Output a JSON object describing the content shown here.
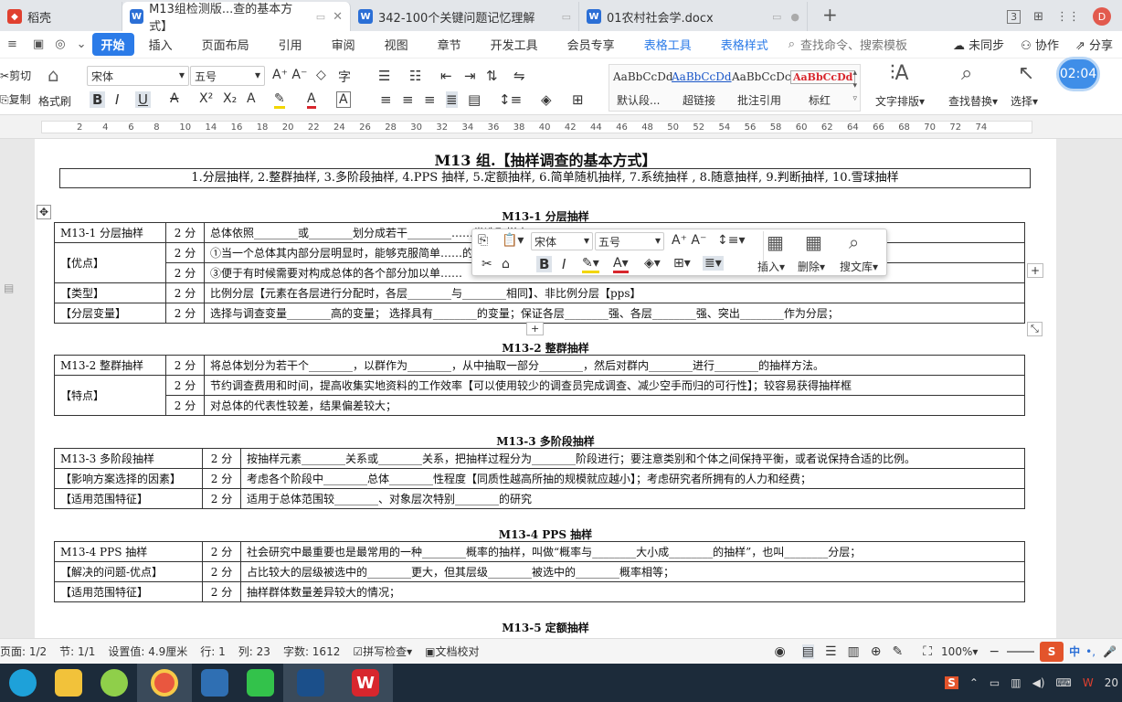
{
  "tabs": [
    {
      "label": "稻壳",
      "icon": "daoke-icon"
    },
    {
      "label": "M13组检测版...查的基本方式】",
      "icon": "word-doc-icon",
      "active": true
    },
    {
      "label": "342-100个关键问题记忆理解",
      "icon": "word-doc-icon"
    },
    {
      "label": "01农村社会学.docx",
      "icon": "word-doc-icon"
    }
  ],
  "window": {
    "avatar_letter": "D",
    "page_count_icon": "3"
  },
  "menu": {
    "items": [
      "开始",
      "插入",
      "页面布局",
      "引用",
      "审阅",
      "视图",
      "章节",
      "开发工具",
      "会员专享",
      "表格工具",
      "表格样式"
    ],
    "search_placeholder": "查找命令、搜索模板",
    "right": [
      "未同步",
      "协作",
      "分享"
    ]
  },
  "ribbon": {
    "cut": "剪切",
    "copy": "复制",
    "format_painter": "格式刷",
    "font_name": "宋体",
    "font_size": "五号",
    "styles": [
      {
        "sample": "AaBbCcDd",
        "label": "默认段...",
        "color": "#222222"
      },
      {
        "sample": "AaBbCcDd",
        "label": "超链接",
        "color": "#1a56c8"
      },
      {
        "sample": "AaBbCcDc",
        "label": "批注引用",
        "color": "#222222"
      },
      {
        "sample": "AaBbCcDd",
        "label": "标红",
        "color": "#d8262d"
      }
    ],
    "text_layout": "文字排版",
    "find_replace": "查找替换",
    "select": "选择",
    "clock": "02:04"
  },
  "ruler": [
    "2",
    "4",
    "6",
    "8",
    "10",
    "14",
    "16",
    "18",
    "20",
    "22",
    "24",
    "26",
    "28",
    "30",
    "32",
    "34",
    "36",
    "38",
    "40",
    "42",
    "44",
    "46",
    "48",
    "50",
    "52",
    "54",
    "56",
    "58",
    "60",
    "62",
    "64",
    "66",
    "68",
    "70",
    "72",
    "74"
  ],
  "doc": {
    "title": "M13 组.【抽样调查的基本方式】",
    "subtitle": "1.分层抽样, 2.整群抽样, 3.多阶段抽样, 4.PPS 抽样, 5.定额抽样, 6.简单随机抽样, 7.系统抽样 , 8.随意抽样, 9.判断抽样, 10.雪球抽样",
    "s1": {
      "heading": "M13-1 分层抽样",
      "rows": [
        [
          "M13-1 分层抽样",
          "2 分",
          "总体依照________或________划分成若干________……类选取样本；"
        ],
        [
          "【优点】",
          "2 分",
          "①当一个总体其内部分层明显时，能够克服简单……的________；"
        ],
        [
          "",
          "2 分",
          "③便于有时候需要对构成总体的各个部分加以单……"
        ],
        [
          "【类型】",
          "2 分",
          "比例分层【元素在各层进行分配时，各层________与________相同】、非比例分层【pps】"
        ],
        [
          "【分层变量】",
          "2 分",
          "选择与调查变量________高的变量； 选择具有________的变量；保证各层________强、各层________强、突出________作为分层；"
        ]
      ]
    },
    "s2": {
      "heading": "M13-2 整群抽样",
      "rows": [
        [
          "M13-2 整群抽样",
          "2 分",
          "将总体划分为若干个________，以群作为________，从中抽取一部分________，然后对群内________进行________的抽样方法。"
        ],
        [
          "【特点】",
          "2 分",
          "节约调查费用和时间，提高收集实地资料的工作效率【可以使用较少的调查员完成调查、减少空手而归的可行性】；较容易获得抽样框"
        ],
        [
          "",
          "2 分",
          "对总体的代表性较差，结果偏差较大；"
        ]
      ]
    },
    "s3": {
      "heading": "M13-3 多阶段抽样",
      "rows": [
        [
          "M13-3 多阶段抽样",
          "2 分",
          "按抽样元素________关系或________关系，把抽样过程分为________阶段进行；要注意类别和个体之间保持平衡，或者说保持合适的比例。"
        ],
        [
          "【影响方案选择的因素】",
          "2 分",
          "考虑各个阶段中________总体________性程度【同质性越高所抽的规模就应越小】；考虑研究者所拥有的人力和经费；"
        ],
        [
          "【适用范围特征】",
          "2 分",
          "适用于总体范围较________、对象层次特别________的研究"
        ]
      ]
    },
    "s4": {
      "heading": "M13-4 PPS 抽样",
      "rows": [
        [
          "M13-4 PPS 抽样",
          "2 分",
          "社会研究中最重要也是最常用的一种________概率的抽样，叫做“概率与________大小成________的抽样”，也叫________分层；"
        ],
        [
          "【解决的问题-优点】",
          "2 分",
          "占比较大的层级被选中的________更大，但其层级________被选中的________概率相等；"
        ],
        [
          "【适用范围特征】",
          "2 分",
          "抽样群体数量差异较大的情况；"
        ]
      ]
    },
    "s5": {
      "heading": "M13-5 定额抽样"
    }
  },
  "minibar": {
    "font_name": "宋体",
    "font_size": "五号",
    "insert": "插入",
    "delete": "删除",
    "library": "搜文库"
  },
  "status": {
    "page": "页面: 1/2",
    "section": "节: 1/1",
    "setting": "设置值: 4.9厘米",
    "row": "行: 1",
    "col": "列: 23",
    "words": "字数: 1612",
    "spell": "拼写检查",
    "proof": "文档校对",
    "zoom": "100%"
  },
  "taskbar": [
    "edge-icon",
    "explorer-icon",
    "settings-icon",
    "browser-icon",
    "calculator-icon",
    "wechat-icon",
    "app-icon",
    "wps-icon"
  ],
  "tray": {
    "ime": "中",
    "clock_partial": "20"
  }
}
